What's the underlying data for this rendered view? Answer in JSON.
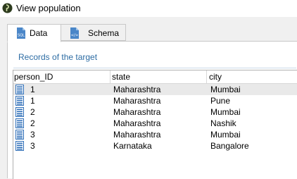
{
  "window": {
    "title": "View population"
  },
  "tabs": [
    {
      "label": "Data",
      "icon": "sql-file-icon"
    },
    {
      "label": "Schema",
      "icon": "code-file-icon"
    }
  ],
  "section": {
    "title": "Records of the target"
  },
  "table": {
    "columns": [
      "person_ID",
      "state",
      "city"
    ],
    "rows": [
      {
        "person_ID": "1",
        "state": "Maharashtra",
        "city": "Mumbai"
      },
      {
        "person_ID": "1",
        "state": "Maharashtra",
        "city": "Pune"
      },
      {
        "person_ID": "2",
        "state": "Maharashtra",
        "city": "Mumbai"
      },
      {
        "person_ID": "2",
        "state": "Maharashtra",
        "city": "Nashik"
      },
      {
        "person_ID": "3",
        "state": "Maharashtra",
        "city": "Mumbai"
      },
      {
        "person_ID": "3",
        "state": "Karnataka",
        "city": "Bangalore"
      }
    ],
    "selected_row": 0
  },
  "colors": {
    "accent": "#2e6da4",
    "icon_blue": "#2f6fb8",
    "selected_row": "#e9e9e9"
  }
}
